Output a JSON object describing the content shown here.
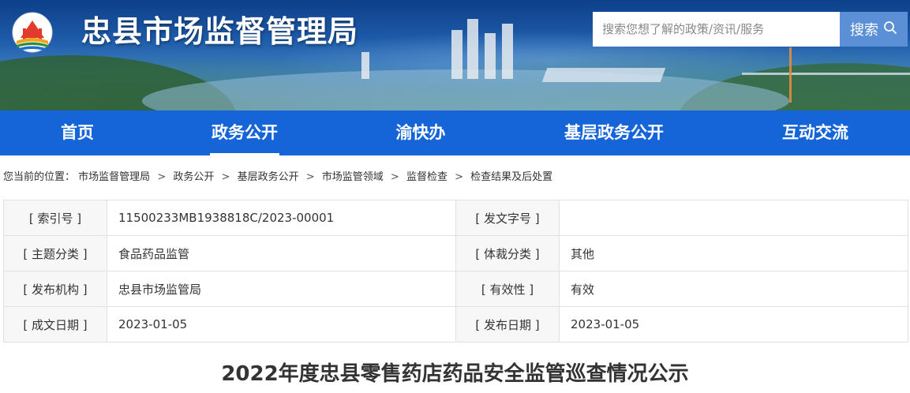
{
  "header": {
    "site_title": "忠县市场监督管理局",
    "search_placeholder": "搜索您想了解的政策/资讯/服务",
    "search_button": "搜索",
    "search_icon": "search-icon",
    "logo_icon": "emblem-logo-icon"
  },
  "nav": {
    "items": [
      {
        "label": "首页"
      },
      {
        "label": "政务公开"
      },
      {
        "label": "渝快办"
      },
      {
        "label": "基层政务公开"
      },
      {
        "label": "互动交流"
      }
    ],
    "active_index": 1
  },
  "breadcrumb": {
    "prefix": "您当前的位置：",
    "items": [
      "市场监督管理局",
      "政务公开",
      "基层政务公开",
      "市场监管领域",
      "监督检查",
      "检查结果及后处置"
    ],
    "separator": ">"
  },
  "meta": {
    "rows": [
      {
        "l1": "[ 索引号 ]",
        "v1": "11500233MB1938818C/2023-00001",
        "l2": "[ 发文字号 ]",
        "v2": ""
      },
      {
        "l1": "[ 主题分类 ]",
        "v1": "食品药品监管",
        "l2": "[ 体裁分类 ]",
        "v2": "其他"
      },
      {
        "l1": "[ 发布机构 ]",
        "v1": "忠县市场监管局",
        "l2": "[ 有效性 ]",
        "v2": "有效"
      },
      {
        "l1": "[ 成文日期 ]",
        "v1": "2023-01-05",
        "l2": "[ 发布日期 ]",
        "v2": "2023-01-05"
      }
    ]
  },
  "article": {
    "title": "2022年度忠县零售药店药品安全监管巡查情况公示"
  },
  "colors": {
    "nav_bg": "#1565d8",
    "search_button_bg": "#5b8fd6"
  }
}
